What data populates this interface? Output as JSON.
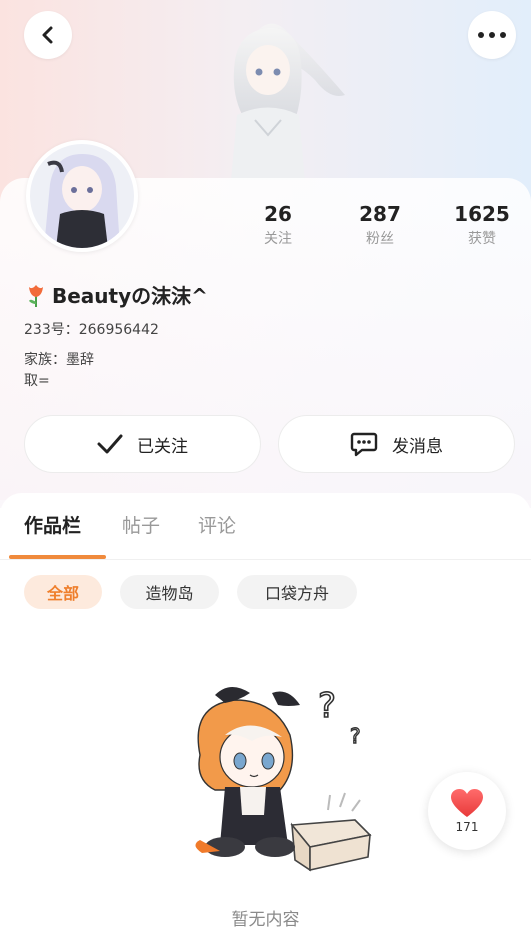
{
  "header": {
    "back_icon": "chevron-left-icon",
    "more_icon": "ellipsis-icon"
  },
  "profile": {
    "avatar": "avatar-image",
    "nickname": "Beautyの沫沫^",
    "nickname_icon": "tulip-icon",
    "id_line": "233号：266956442",
    "family_line": "家族：墨辞",
    "extra_line": "取="
  },
  "stats": [
    {
      "value": "26",
      "label": "关注"
    },
    {
      "value": "287",
      "label": "粉丝"
    },
    {
      "value": "1625",
      "label": "获赞"
    }
  ],
  "actions": {
    "follow_label": "已关注",
    "follow_icon": "check-icon",
    "message_label": "发消息",
    "message_icon": "chat-bubble-icon"
  },
  "tabs": [
    "作品栏",
    "帖子",
    "评论"
  ],
  "active_tab": "作品栏",
  "chips": [
    "全部",
    "造物岛",
    "口袋方舟"
  ],
  "active_chip": "全部",
  "empty_state": {
    "text": "暂无内容",
    "illustration": "empty-box-character"
  },
  "like_fab": {
    "icon": "heart-icon",
    "count": "171"
  },
  "colors": {
    "accent": "#ef7f2c",
    "like": "#f0534f"
  }
}
